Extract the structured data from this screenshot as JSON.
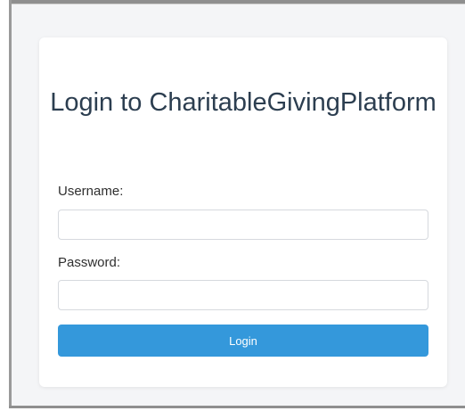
{
  "login_card": {
    "title": "Login to CharitableGivingPlatform",
    "username_label": "Username:",
    "username_value": "",
    "username_placeholder": "",
    "password_label": "Password:",
    "password_value": "",
    "password_placeholder": "",
    "login_button_label": "Login"
  },
  "colors": {
    "page_background": "#f4f5f7",
    "card_background": "#ffffff",
    "title_text": "#2c3e50",
    "button_background": "#3498db",
    "button_text": "#ffffff",
    "input_border": "#d6d9de"
  }
}
